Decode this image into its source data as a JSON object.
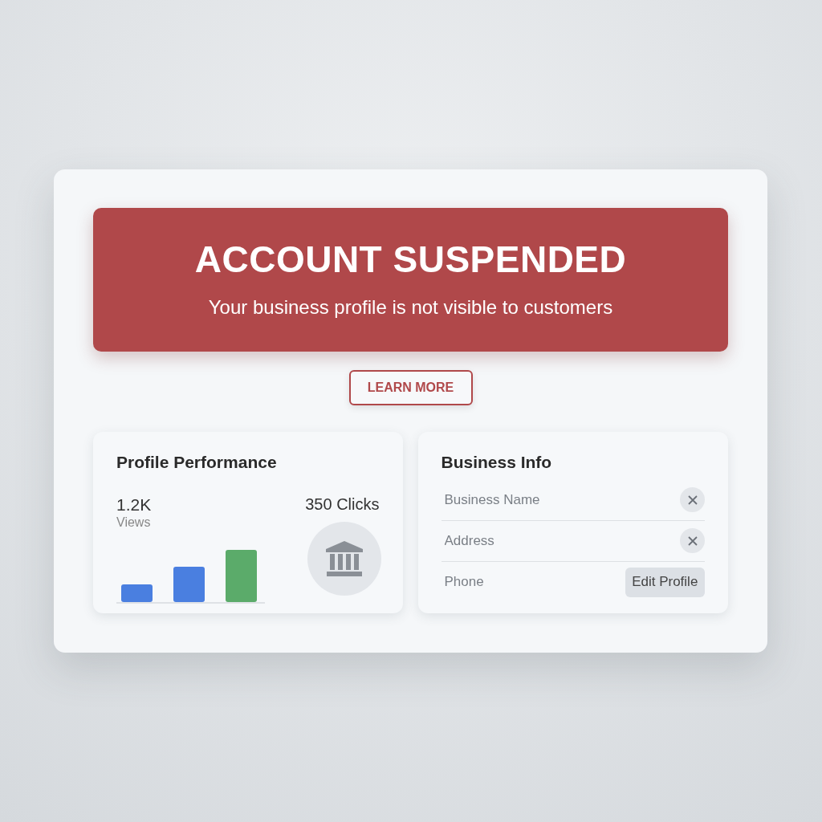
{
  "alert": {
    "title": "ACCOUNT SUSPENDED",
    "message": "Your business profile is not visible to customers"
  },
  "learn_more_button": "LEARN MORE",
  "performance": {
    "title": "Profile Performance",
    "views_value": "1.2K",
    "views_label": "Views",
    "clicks": "350 Clicks"
  },
  "business_info": {
    "title": "Business Info",
    "fields": [
      {
        "placeholder": "Business Name",
        "clearable": true
      },
      {
        "placeholder": "Address",
        "clearable": true
      },
      {
        "placeholder": "Phone",
        "clearable": false
      }
    ],
    "edit_button": "Edit Profile"
  }
}
